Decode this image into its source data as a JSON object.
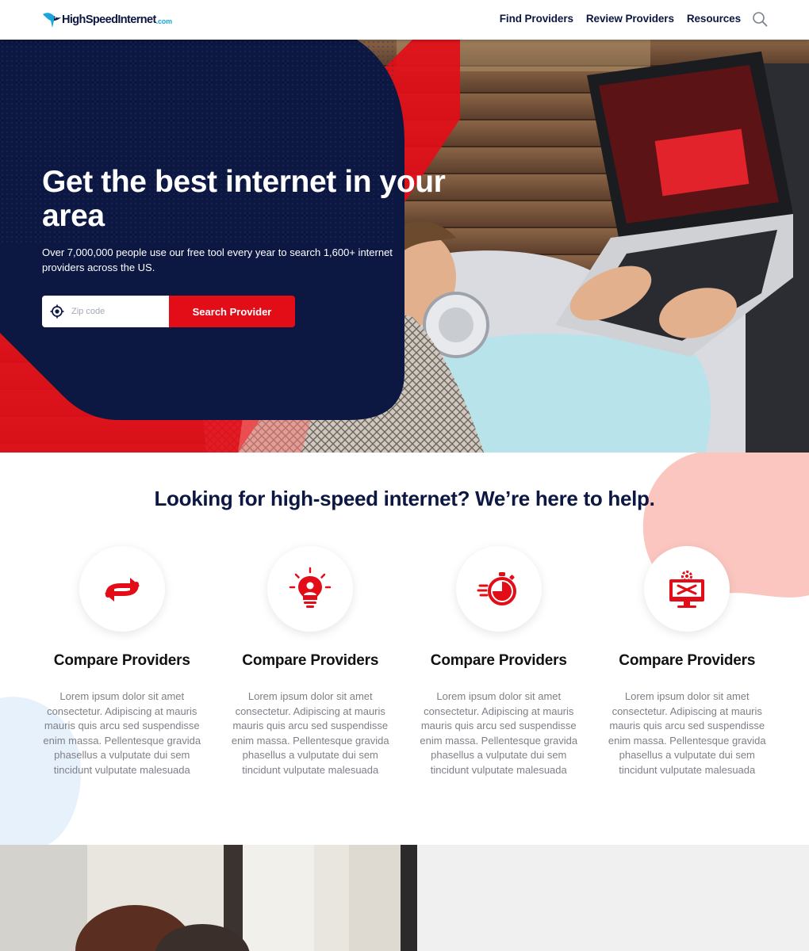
{
  "header": {
    "logo_text": "HighSpeedInternet",
    "logo_domain": ".com",
    "nav": [
      "Find Providers",
      "Review Providers",
      "Resources"
    ],
    "search_icon": "search-icon"
  },
  "hero": {
    "title": "Get the best internet in your area",
    "subtitle": "Over 7,000,000 people use our free tool every  year to search 1,600+ internet providers across the US.",
    "zip_placeholder": "Zip code",
    "zip_value": "",
    "zip_icon": "location-target-icon",
    "search_button": "Search Provider"
  },
  "help": {
    "title": "Looking for high-speed internet? We’re here to help.",
    "features": [
      {
        "icon": "swap-arrows-icon",
        "title": "Compare Providers",
        "text": "Lorem ipsum dolor sit amet consectetur. Adipiscing at mauris mauris quis arcu sed suspendisse enim massa. Pellentesque gravida phasellus a vulputate dui sem tincidunt vulputate malesuada"
      },
      {
        "icon": "user-lightbulb-icon",
        "title": "Compare Providers",
        "text": "Lorem ipsum dolor sit amet consectetur. Adipiscing at mauris mauris quis arcu sed suspendisse enim massa. Pellentesque gravida phasellus a vulputate dui sem tincidunt vulputate malesuada"
      },
      {
        "icon": "fast-stopwatch-icon",
        "title": "Compare Providers",
        "text": "Lorem ipsum dolor sit amet consectetur. Adipiscing at mauris mauris quis arcu sed suspendisse enim massa. Pellentesque gravida phasellus a vulputate dui sem tincidunt vulputate malesuada"
      },
      {
        "icon": "monitor-tools-icon",
        "title": "Compare Providers",
        "text": "Lorem ipsum dolor sit amet consectetur. Adipiscing at mauris mauris quis arcu sed suspendisse enim massa. Pellentesque gravida phasellus a vulputate dui sem tincidunt vulputate malesuada"
      }
    ]
  },
  "colors": {
    "navy": "#0c1742",
    "red": "#e30d18",
    "pink_blob": "#fcc6c0",
    "blue_blob": "#e7f1fc",
    "body_text": "#7f8087"
  }
}
